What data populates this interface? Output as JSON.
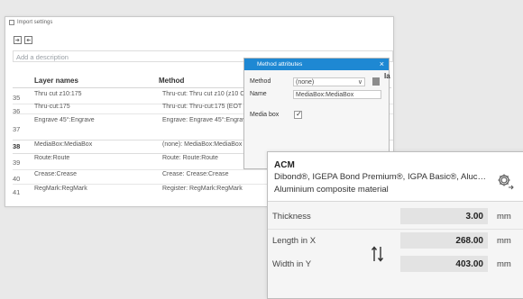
{
  "import_window": {
    "title": "Import settings",
    "description_placeholder": "Add a description",
    "columns": {
      "layer_names": "Layer names",
      "method": "Method"
    },
    "rows": [
      {
        "num": "35",
        "layer": "Thru cut z10:175",
        "method": "Thru-cut: Thru cut z10 (z10 C"
      },
      {
        "num": "36",
        "layer": "Thru-cut:175",
        "method": "Thru-cut: Thru-cut:175 (EOT"
      },
      {
        "num": "37",
        "layer": "Engrave 45°:Engrave",
        "method": "Engrave: Engrave 45°:Engrave"
      },
      {
        "num": "38",
        "layer": "MediaBox:MediaBox",
        "method": "(none): MediaBox:MediaBox",
        "selected": true
      },
      {
        "num": "39",
        "layer": "Route:Route",
        "method": "Route: Route:Route"
      },
      {
        "num": "40",
        "layer": "Crease:Crease",
        "method": "Crease: Crease:Crease"
      },
      {
        "num": "41",
        "layer": "RegMark:RegMark",
        "method": "Register: RegMark:RegMark"
      }
    ],
    "right_partial_header": "la"
  },
  "method_dialog": {
    "title": "Method attributes",
    "close": "×",
    "method_label": "Method",
    "method_value": "(none)",
    "name_label": "Name",
    "name_value": "MediaBox:MediaBox",
    "mediabox_label": "Media box",
    "mediabox_checked": "✓",
    "swatch_color": "#8c8c8c",
    "accent_color": "#1e88d3"
  },
  "material_panel": {
    "name": "ACM",
    "brands": "Dibond®, IGEPA Bond Premium®, IGPA Basic®, Aluc…",
    "description": "Aluminium composite material",
    "properties": [
      {
        "label": "Thickness",
        "value": "3.00",
        "unit": "mm"
      },
      {
        "label": "Length in X",
        "value": "268.00",
        "unit": "mm"
      },
      {
        "label": "Width in Y",
        "value": "403.00",
        "unit": "mm"
      }
    ],
    "gear_icon": "gear-icon",
    "swap_icon": "swap-arrows-icon"
  }
}
